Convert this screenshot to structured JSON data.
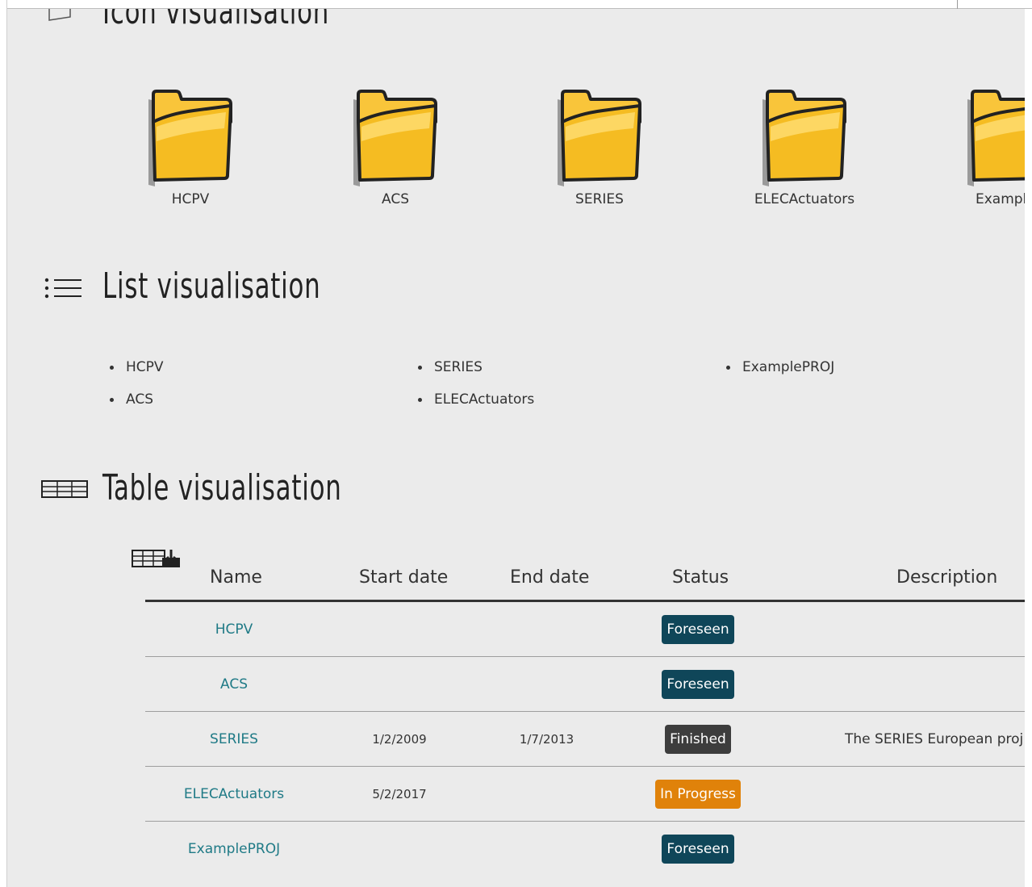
{
  "sections": {
    "icon": {
      "title": "Icon visualisation"
    },
    "list": {
      "title": "List visualisation"
    },
    "table": {
      "title": "Table visualisation"
    }
  },
  "projects": [
    {
      "name": "HCPV"
    },
    {
      "name": "ACS"
    },
    {
      "name": "SERIES"
    },
    {
      "name": "ELECActuators"
    },
    {
      "name": "ExampleP"
    }
  ],
  "list_columns": [
    [
      "HCPV",
      "ACS"
    ],
    [
      "SERIES",
      "ELECActuators"
    ],
    [
      "ExamplePROJ"
    ]
  ],
  "table": {
    "export_icon": "table-export-icon",
    "headers": [
      "Name",
      "Start date",
      "End date",
      "Status",
      "Description"
    ],
    "rows": [
      {
        "name": "HCPV",
        "start": "",
        "end": "",
        "status": "Foreseen",
        "status_color": "#0f4659",
        "description": ""
      },
      {
        "name": "ACS",
        "start": "",
        "end": "",
        "status": "Foreseen",
        "status_color": "#0f4659",
        "description": ""
      },
      {
        "name": "SERIES",
        "start": "1/2/2009",
        "end": "1/7/2013",
        "status": "Finished",
        "status_color": "#3d3d3d",
        "description": "The SERIES European proj"
      },
      {
        "name": "ELECActuators",
        "start": "5/2/2017",
        "end": "",
        "status": "In Progress",
        "status_color": "#e0820a",
        "description": ""
      },
      {
        "name": "ExamplePROJ",
        "start": "",
        "end": "",
        "status": "Foreseen",
        "status_color": "#0f4659",
        "description": ""
      }
    ]
  },
  "colors": {
    "link": "#1f7a86",
    "panel_bg": "#ebebeb",
    "folder": "#f7c331"
  }
}
